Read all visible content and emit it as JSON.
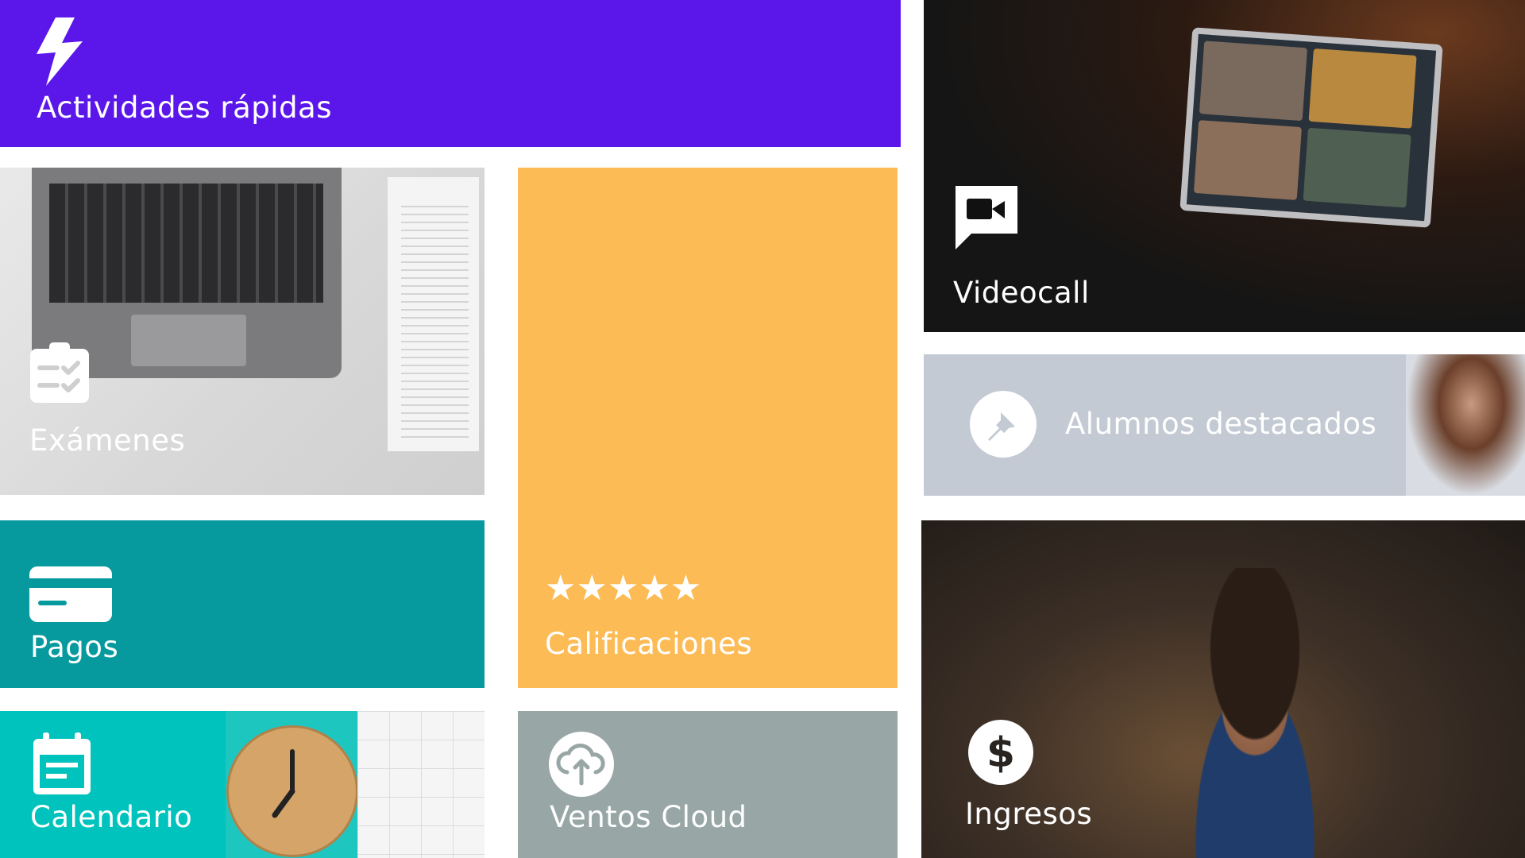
{
  "tiles": {
    "actividades": {
      "label": "Actividades rápidas",
      "icon": "lightning-bolt-icon",
      "color": "#5b17ea"
    },
    "examenes": {
      "label": "Exámenes",
      "icon": "clipboard-check-icon"
    },
    "calificaciones": {
      "label": "Calificaciones",
      "icon": "five-stars-icon",
      "color": "#fdbb56",
      "stars": "★★★★★"
    },
    "videocall": {
      "label": "Videocall",
      "icon": "video-camera-icon"
    },
    "alumnos": {
      "label": "Alumnos destacados",
      "icon": "pin-icon",
      "color": "#c4cad3"
    },
    "pagos": {
      "label": "Pagos",
      "icon": "credit-card-icon",
      "color": "#06999e"
    },
    "calendario": {
      "label": "Calendario",
      "icon": "calendar-icon",
      "color": "#00c3bd"
    },
    "ventos": {
      "label": "Ventos Cloud",
      "icon": "cloud-upload-icon",
      "color": "#98a7a5"
    },
    "ingresos": {
      "label": "Ingresos",
      "icon": "dollar-icon"
    }
  }
}
